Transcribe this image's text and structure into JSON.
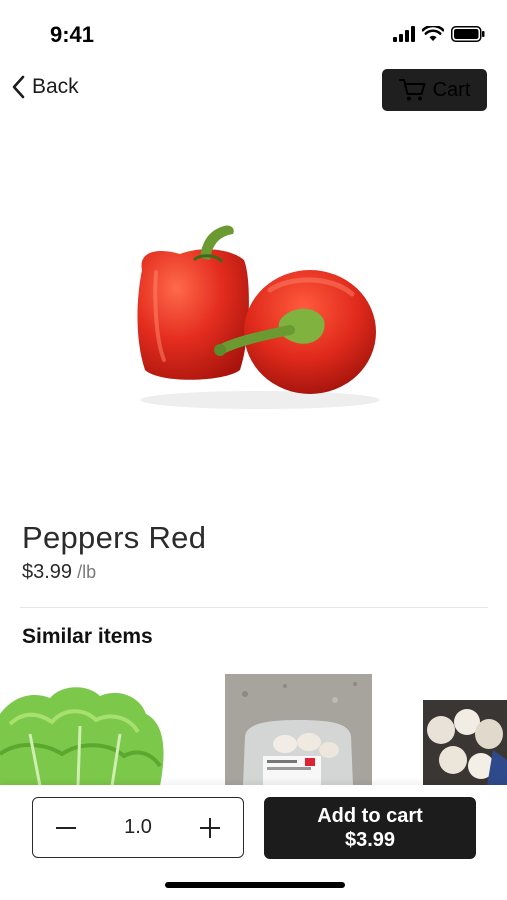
{
  "status_bar": {
    "time": "9:41",
    "icons": [
      "signal-icon",
      "wifi-icon",
      "battery-icon"
    ]
  },
  "nav": {
    "back_label": "Back",
    "back_icon": "chevron-left-icon",
    "cart_label": "Cart",
    "cart_icon": "cart-icon"
  },
  "product": {
    "name": "Peppers Red",
    "price": "$3.99",
    "unit": "/lb",
    "image": "red-bell-peppers-image"
  },
  "similar": {
    "heading": "Similar items",
    "items": [
      {
        "image": "lettuce-image"
      },
      {
        "image": "packaged-mushrooms-image"
      },
      {
        "image": "garlic-image"
      }
    ]
  },
  "purchase": {
    "quantity": "1.0",
    "decrement_icon": "minus-icon",
    "increment_icon": "plus-icon",
    "add_label": "Add to cart",
    "add_price": "$3.99"
  },
  "colors": {
    "button_dark": "#1c1c1c",
    "pepper_red": "#e42d1f",
    "stem_green": "#5d8a2a"
  }
}
